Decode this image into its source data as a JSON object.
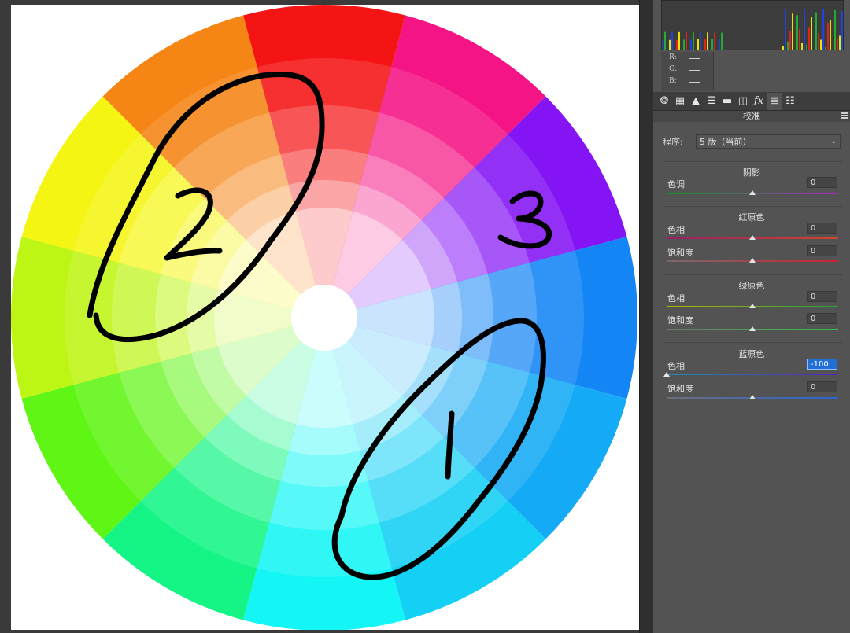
{
  "canvas": {
    "annotations": [
      {
        "label": "1"
      },
      {
        "label": "2"
      },
      {
        "label": "3"
      }
    ]
  },
  "panel": {
    "readout": {
      "r": "R:",
      "g": "G:",
      "b": "B:"
    },
    "tabs": [
      "basic-icon",
      "tone-curve-icon",
      "detail-icon",
      "hsl-icon",
      "split-toning-icon",
      "lens-icon",
      "fx-icon",
      "calibration-icon",
      "presets-icon"
    ],
    "title": "校准",
    "process": {
      "label": "程序:",
      "value": "5 版（当前）"
    },
    "sections": [
      {
        "title": "阴影",
        "controls": [
          {
            "label": "色调",
            "value": "0",
            "position": 0.5,
            "colors": [
              "#0f9a22",
              "#b025c9"
            ]
          }
        ]
      },
      {
        "title": "红原色",
        "controls": [
          {
            "label": "色相",
            "value": "0",
            "position": 0.5,
            "colors": [
              "#9a1e63",
              "#d0452a"
            ]
          },
          {
            "label": "饱和度",
            "value": "0",
            "position": 0.5,
            "colors": [
              "#7a6a6a",
              "#cc2233"
            ]
          }
        ]
      },
      {
        "title": "绿原色",
        "controls": [
          {
            "label": "色相",
            "value": "0",
            "position": 0.5,
            "colors": [
              "#b5b100",
              "#1fa838"
            ]
          },
          {
            "label": "饱和度",
            "value": "0",
            "position": 0.5,
            "colors": [
              "#6b7a6b",
              "#2cc23f"
            ]
          }
        ]
      },
      {
        "title": "蓝原色",
        "controls": [
          {
            "label": "色相",
            "value": "-100",
            "position": 0.0,
            "active": true,
            "colors": [
              "#1c8fb0",
              "#5a1fc0"
            ]
          },
          {
            "label": "饱和度",
            "value": "0",
            "position": 0.5,
            "colors": [
              "#6b6f7a",
              "#2a63d6"
            ]
          }
        ]
      }
    ]
  }
}
